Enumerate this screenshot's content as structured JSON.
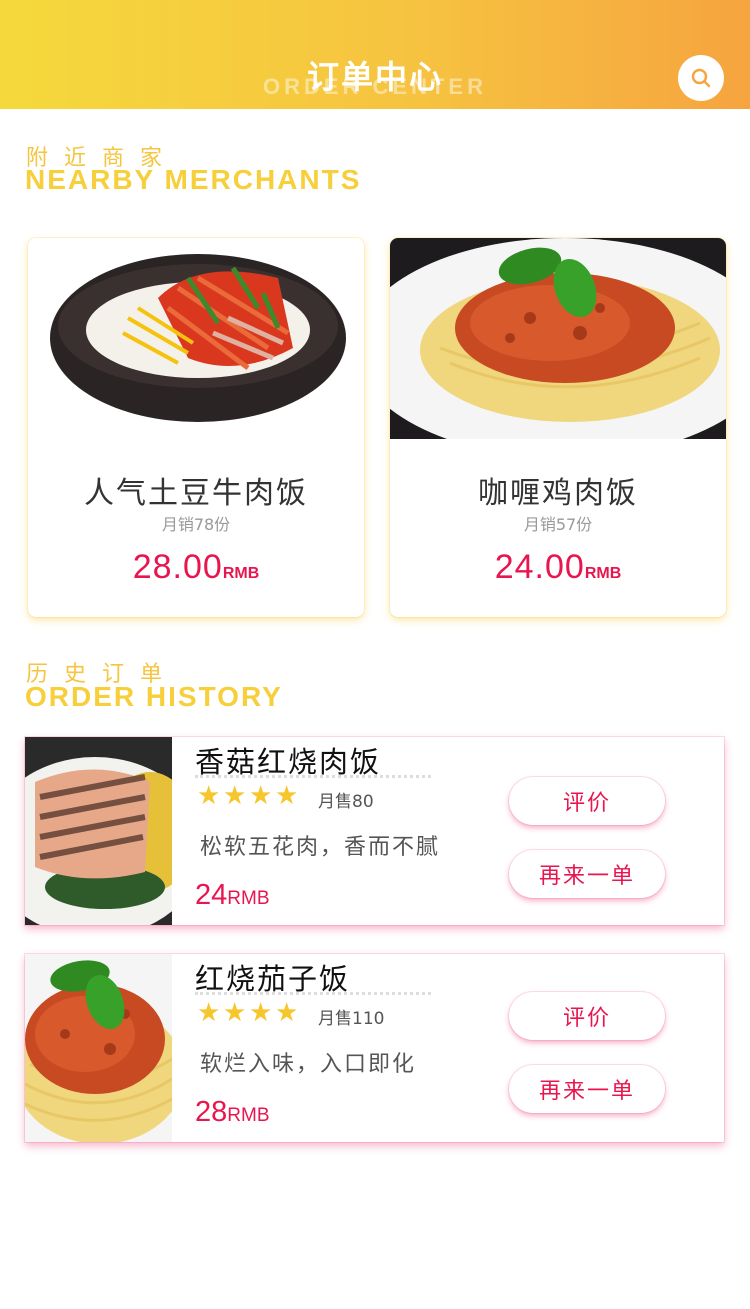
{
  "header": {
    "title": "订单中心",
    "subtitle": "ORDER CENTER",
    "search_icon": "search-icon"
  },
  "nearby": {
    "title_cn": "附近商家",
    "title_en": "NEARBY MERCHANTS",
    "items": [
      {
        "name": "人气土豆牛肉饭",
        "sales": "月销78份",
        "price": "28.00",
        "unit": "RMB",
        "image": "bibimbap-bowl"
      },
      {
        "name": "咖喱鸡肉饭",
        "sales": "月销57份",
        "price": "24.00",
        "unit": "RMB",
        "image": "spaghetti-plate"
      }
    ]
  },
  "history": {
    "title_cn": "历史订单",
    "title_en": "ORDER HISTORY",
    "items": [
      {
        "name": "香菇红烧肉饭",
        "rating": 4,
        "monthly": "月售80",
        "desc": "松软五花肉，香而不腻",
        "price": "24",
        "unit": "RMB",
        "review_label": "评价",
        "reorder_label": "再来一单",
        "image": "grilled-salmon"
      },
      {
        "name": "红烧茄子饭",
        "rating": 4,
        "monthly": "月售110",
        "desc": "软烂入味，入口即化",
        "price": "28",
        "unit": "RMB",
        "review_label": "评价",
        "reorder_label": "再来一单",
        "image": "spaghetti-plate"
      }
    ]
  },
  "colors": {
    "accent": "#e8154f",
    "header_start": "#f5d93c",
    "header_end": "#f6a43f",
    "section_title": "#f6cf3a",
    "star": "#f7c52c"
  }
}
